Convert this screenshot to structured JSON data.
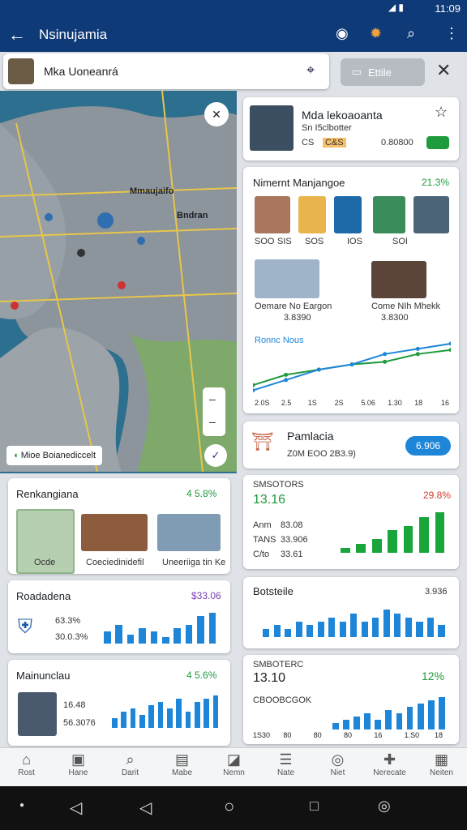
{
  "status": {
    "time": "11:09"
  },
  "appbar": {
    "title": "Nsinujamia"
  },
  "search": {
    "value": "Mka Uoneanrá",
    "filter_label": "Ettile"
  },
  "map": {
    "label1": "Mmaujaifo",
    "label2": "Bndran",
    "chip": "Mioe Boianediccelt"
  },
  "profile": {
    "name": "Mda lekoaoanta",
    "sub": "Sn I5clbotter",
    "tags": [
      "CS",
      "C&S"
    ],
    "value": "0.80800"
  },
  "market": {
    "title": "Nimernt Manjangoe",
    "pct": "21.3%",
    "thumb_labels": [
      "SOO",
      "SIS",
      "SOS",
      "IOS",
      "SOI"
    ],
    "photo1_title": "Oemare No Eargon",
    "photo1_val": "3.8390",
    "photo2_title": "Come NIh Mhekk",
    "photo2_val": "3.8300",
    "chart_title": "Ronnc Nous",
    "x_labels": [
      "2.0S",
      "2.5",
      "1S",
      "2S",
      "5.06",
      "1.30",
      "18",
      "16"
    ]
  },
  "pamlacia": {
    "title": "Pamlacia",
    "sub": "Z0M EOO 2B3.9)",
    "badge": "6.906"
  },
  "stats1": {
    "title": "SMSOTORS",
    "value": "13.16",
    "pct": "29.8%",
    "rows": [
      {
        "k": "Anm",
        "v": "83.08"
      },
      {
        "k": "TANS",
        "v": "33.906"
      },
      {
        "k": "C/to",
        "v": "33.61"
      }
    ]
  },
  "botsteile": {
    "title": "Botsteile",
    "value": "3.936"
  },
  "stats2": {
    "title": "SMBOTERC",
    "value": "13.10",
    "pct": "12%",
    "sub": "CBOOBCGOK",
    "x_labels": [
      "1S30",
      "80",
      "80",
      "80",
      "16",
      "1.S0",
      "18"
    ]
  },
  "left1": {
    "title": "Renkangiana",
    "pct": "4 5.8%",
    "cap1": "Ocde",
    "cap2": "Coeciedinidefil",
    "cap3": "Uneeriiga tin Ke"
  },
  "left2": {
    "title": "Roadadena",
    "value": "$33.06",
    "v1": "63.3%",
    "v2": "30.0.3%"
  },
  "left3": {
    "title": "Mainunclau",
    "pct": "4 5.6%",
    "v1": "16.48",
    "v2": "56.3076"
  },
  "nav": [
    "Rost",
    "Hane",
    "Darit",
    "Mabe",
    "Nemn",
    "Nate",
    "Niet",
    "Nerecate",
    "Neiten"
  ],
  "chart_data": [
    {
      "type": "line",
      "title": "Ronnc Nous",
      "series": [
        {
          "values": [
            2,
            4,
            5,
            6,
            6.5,
            8,
            8.8
          ]
        },
        {
          "values": [
            1,
            3,
            5,
            6,
            8,
            9,
            10
          ]
        }
      ]
    },
    {
      "type": "bar",
      "title": "Roadadena",
      "values": [
        4,
        6,
        3,
        5,
        4,
        2,
        5,
        6,
        9,
        10
      ]
    },
    {
      "type": "bar",
      "title": "Mainunclau",
      "values": [
        3,
        5,
        6,
        4,
        7,
        8,
        6,
        9,
        5,
        8,
        9,
        10
      ]
    },
    {
      "type": "bar",
      "title": "SMSOTORS",
      "values": [
        1,
        2,
        3,
        5,
        6,
        8,
        9
      ]
    },
    {
      "type": "bar",
      "title": "Botsteile",
      "values": [
        2,
        3,
        2,
        4,
        3,
        4,
        5,
        4,
        6,
        4,
        5,
        7,
        6,
        5,
        4,
        5,
        3
      ]
    },
    {
      "type": "bar",
      "title": "SMBOTERC",
      "values": [
        2,
        3,
        4,
        5,
        3,
        6,
        5,
        7,
        8,
        9,
        10
      ]
    }
  ]
}
